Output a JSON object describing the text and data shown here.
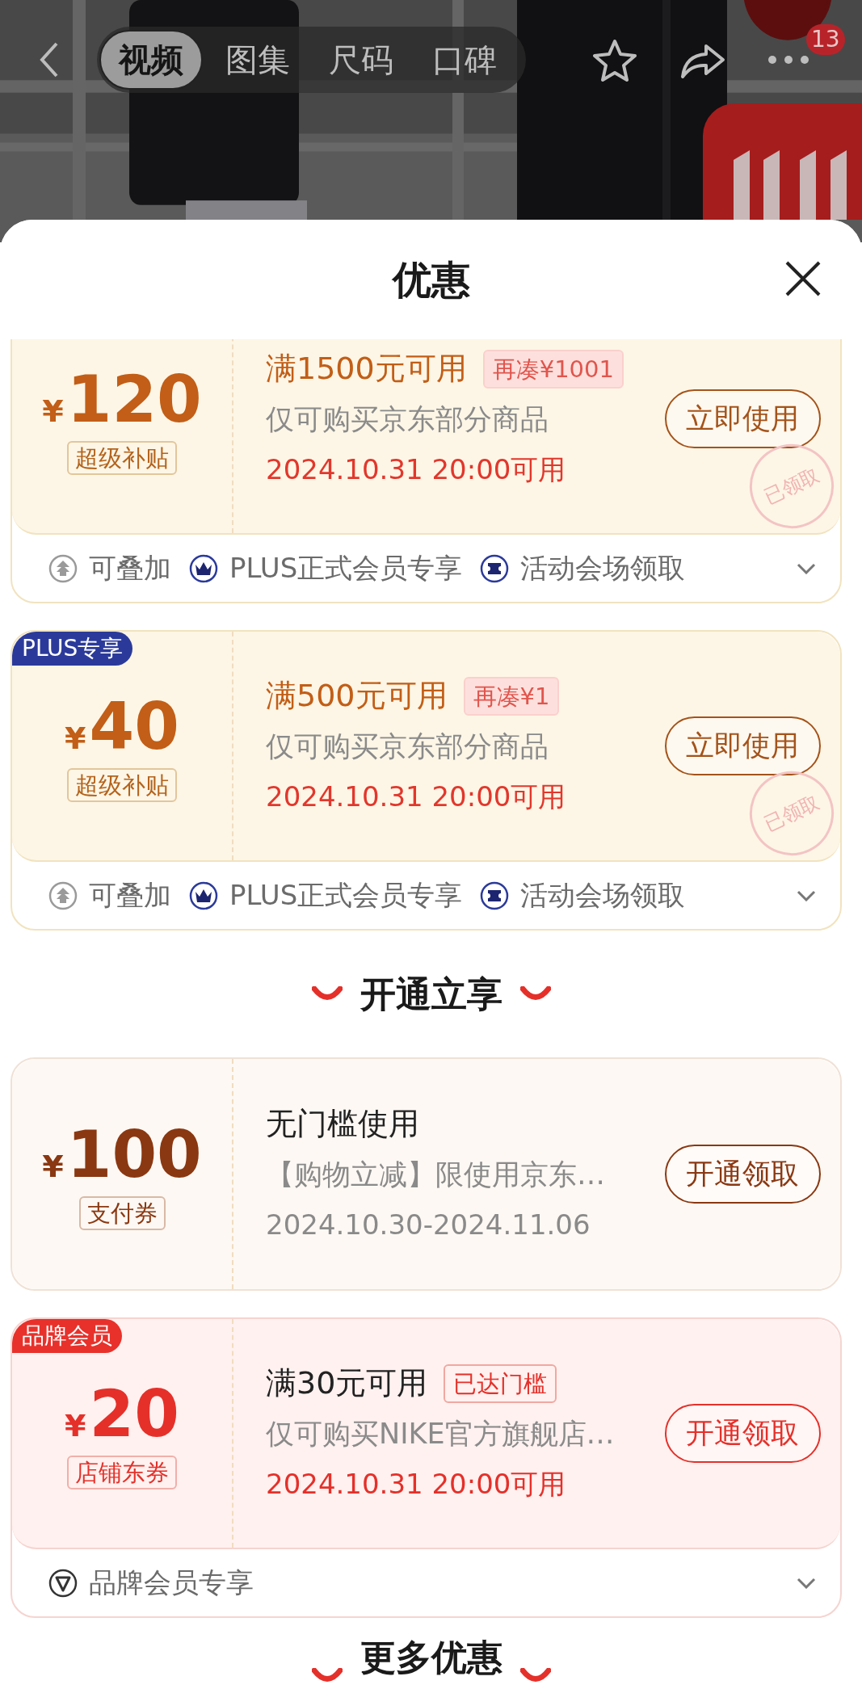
{
  "top_bar": {
    "tabs": [
      {
        "label": "视频",
        "selected": true
      },
      {
        "label": "图集",
        "selected": false
      },
      {
        "label": "尺码",
        "selected": false
      },
      {
        "label": "口碑",
        "selected": false
      }
    ],
    "badge": "13"
  },
  "sheet": {
    "title": "优惠",
    "sections": [
      {
        "coupons": [
          {
            "kind": "gold",
            "currency": "¥",
            "amount": "120",
            "type_tag": "超级补贴",
            "condition": "满1500元可用",
            "threshold": {
              "kind": "gap",
              "text": "再凑¥1001"
            },
            "scope": "仅可购买京东部分商品",
            "validity": "2024.10.31 20:00可用",
            "button": "立即使用",
            "stamp": "已领取",
            "footer": {
              "expanded": false,
              "features": [
                {
                  "kind": "stack",
                  "label": "可叠加"
                },
                {
                  "kind": "crown",
                  "label": "PLUS正式会员专享"
                },
                {
                  "kind": "ticket",
                  "label": "活动会场领取"
                }
              ]
            }
          },
          {
            "kind": "gold",
            "badge": {
              "text": "PLUS专享",
              "color": "#2b3a9a"
            },
            "currency": "¥",
            "amount": "40",
            "type_tag": "超级补贴",
            "condition": "满500元可用",
            "threshold": {
              "kind": "gap",
              "text": "再凑¥1"
            },
            "scope": "仅可购买京东部分商品",
            "validity": "2024.10.31 20:00可用",
            "button": "立即使用",
            "stamp": "已领取",
            "footer": {
              "expanded": false,
              "features": [
                {
                  "kind": "stack",
                  "label": "可叠加"
                },
                {
                  "kind": "crown",
                  "label": "PLUS正式会员专享"
                },
                {
                  "kind": "ticket",
                  "label": "活动会场领取"
                }
              ]
            }
          }
        ]
      },
      {
        "heading": "开通立享",
        "coupons": [
          {
            "kind": "brown",
            "currency": "¥",
            "amount": "100",
            "type_tag": "支付券",
            "condition": "无门槛使用",
            "scope": "【购物立减】限使用京东…",
            "validity": "2024.10.30-2024.11.06",
            "button": "开通领取"
          },
          {
            "kind": "red",
            "badge": {
              "text": "品牌会员",
              "color": "#e8312b"
            },
            "currency": "¥",
            "amount": "20",
            "type_tag": "店铺东券",
            "condition": "满30元可用",
            "threshold": {
              "kind": "met",
              "text": "已达门槛"
            },
            "scope": "仅可购买NIKE官方旗舰店…",
            "validity": "2024.10.31 20:00可用",
            "button": "开通领取",
            "footer": {
              "expanded": false,
              "features": [
                {
                  "kind": "brand",
                  "label": "品牌会员专享"
                }
              ]
            }
          }
        ]
      },
      {
        "heading": "更多优惠"
      }
    ]
  }
}
